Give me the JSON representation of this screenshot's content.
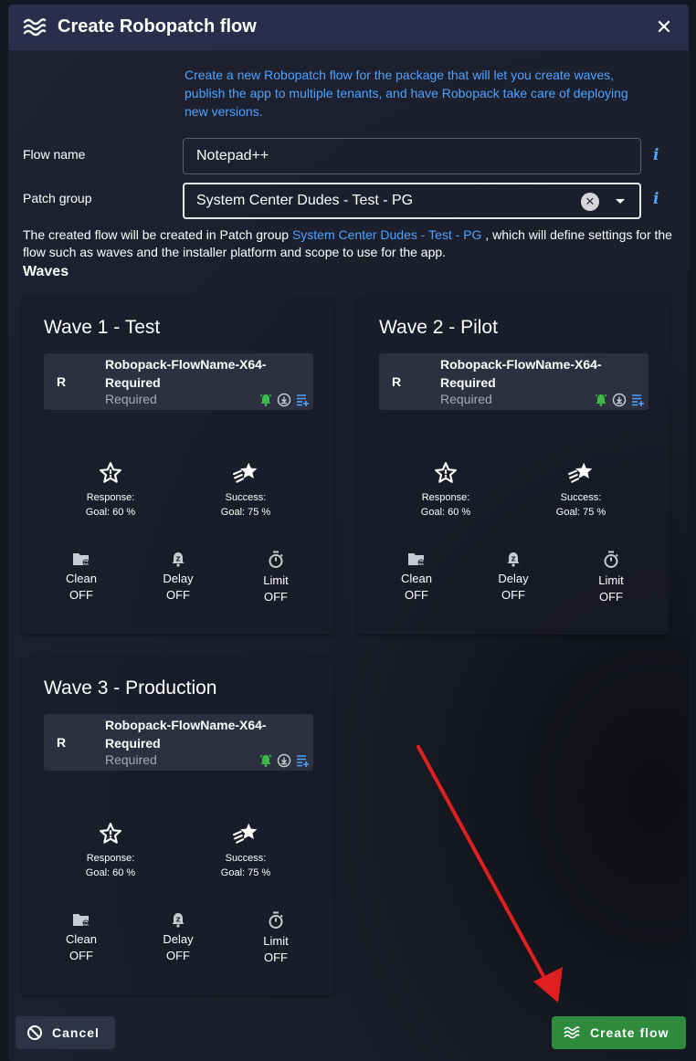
{
  "dialog": {
    "title": "Create Robopatch flow",
    "close_label": "✕",
    "intro": "Create a new Robopatch flow for the package that will let you create waves, publish the app to multiple tenants, and have Robopack take care of deploying new versions."
  },
  "form": {
    "flow_name_label": "Flow name",
    "flow_name_value": "Notepad++",
    "patch_group_label": "Patch group",
    "patch_group_value": "System Center Dudes - Test - PG",
    "info_glyph": "i",
    "clear_glyph": "✕"
  },
  "description": {
    "before": "The created flow will be created in Patch group ",
    "link": "System Center Dudes - Test - PG",
    "after": " , which will define settings for the flow such as waves and the installer platform and scope to use for the app."
  },
  "waves_heading": "Waves",
  "waves": [
    {
      "title": "Wave 1 - Test",
      "assignment": {
        "badge": "R",
        "name": "Robopack-FlowName-X64-Required",
        "type": "Required"
      },
      "response": {
        "label": "Response:",
        "goal": "Goal: 60 %"
      },
      "success": {
        "label": "Success:",
        "goal": "Goal: 75 %"
      },
      "clean": {
        "label": "Clean",
        "value": "OFF"
      },
      "delay": {
        "label": "Delay",
        "value": "OFF"
      },
      "limit": {
        "label": "Limit",
        "value": "OFF"
      }
    },
    {
      "title": "Wave 2 - Pilot",
      "assignment": {
        "badge": "R",
        "name": "Robopack-FlowName-X64-Required",
        "type": "Required"
      },
      "response": {
        "label": "Response:",
        "goal": "Goal: 60 %"
      },
      "success": {
        "label": "Success:",
        "goal": "Goal: 75 %"
      },
      "clean": {
        "label": "Clean",
        "value": "OFF"
      },
      "delay": {
        "label": "Delay",
        "value": "OFF"
      },
      "limit": {
        "label": "Limit",
        "value": "OFF"
      }
    },
    {
      "title": "Wave 3 - Production",
      "assignment": {
        "badge": "R",
        "name": "Robopack-FlowName-X64-Required",
        "type": "Required"
      },
      "response": {
        "label": "Response:",
        "goal": "Goal: 60 %"
      },
      "success": {
        "label": "Success:",
        "goal": "Goal: 75 %"
      },
      "clean": {
        "label": "Clean",
        "value": "OFF"
      },
      "delay": {
        "label": "Delay",
        "value": "OFF"
      },
      "limit": {
        "label": "Limit",
        "value": "OFF"
      }
    }
  ],
  "actions": {
    "cancel_label": "Cancel",
    "create_label": "Create flow"
  },
  "colors": {
    "accent": "#4da3ff",
    "success": "#2e8b3e",
    "annotation_arrow": "#e02020"
  },
  "icons": {
    "title": "robopatch-waves-icon",
    "response": "star-exclamation-icon",
    "success": "shooting-star-icon",
    "clean": "folder-sync-icon",
    "delay": "alarm-clock-icon",
    "limit": "stopwatch-icon"
  }
}
